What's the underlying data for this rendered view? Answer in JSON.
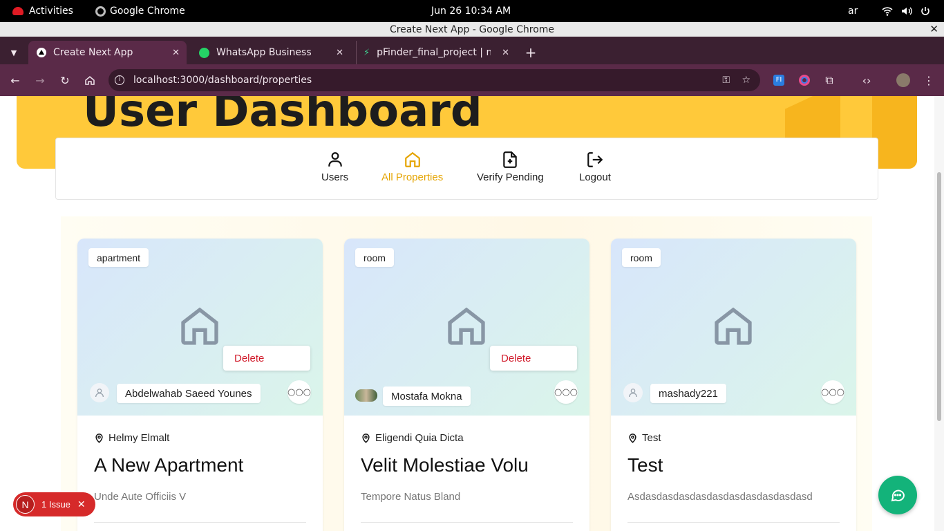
{
  "system": {
    "activities": "Activities",
    "app": "Google Chrome",
    "datetime": "Jun 26  10:34 AM",
    "lang": "ar"
  },
  "window": {
    "title": "Create Next App - Google Chrome"
  },
  "tabs": [
    {
      "label": "Create Next App"
    },
    {
      "label": "WhatsApp Business"
    },
    {
      "label": "pFinder_final_project | m"
    }
  ],
  "omnibox": {
    "url": "localhost:3000/dashboard/properties"
  },
  "hero": {
    "title": "User Dashboard"
  },
  "nav": [
    {
      "label": "Users"
    },
    {
      "label": "All Properties"
    },
    {
      "label": "Verify Pending"
    },
    {
      "label": "Logout"
    }
  ],
  "cards": [
    {
      "type": "apartment",
      "owner": "Abdelwahab Saeed Younes",
      "location": "Helmy Elmalt",
      "title": "A New Apartment",
      "description": "Unde Aute Officiis V",
      "delete_label": "Delete"
    },
    {
      "type": "room",
      "owner": "Mostafa Mokna",
      "location": "Eligendi Quia Dicta",
      "title": "Velit Molestiae Volu",
      "description": "Tempore Natus Bland",
      "delete_label": "Delete"
    },
    {
      "type": "room",
      "owner": "mashady221",
      "location": "Test",
      "title": "Test",
      "description": "Asdasdasdasdasdasdasdasdasdasdasd"
    }
  ],
  "issue_badge": {
    "letter": "N",
    "label": "1 Issue"
  },
  "colors": {
    "accent": "#e5a400",
    "hero": "#ffc93a",
    "danger": "#d11a2a",
    "chat": "#13b37a"
  }
}
